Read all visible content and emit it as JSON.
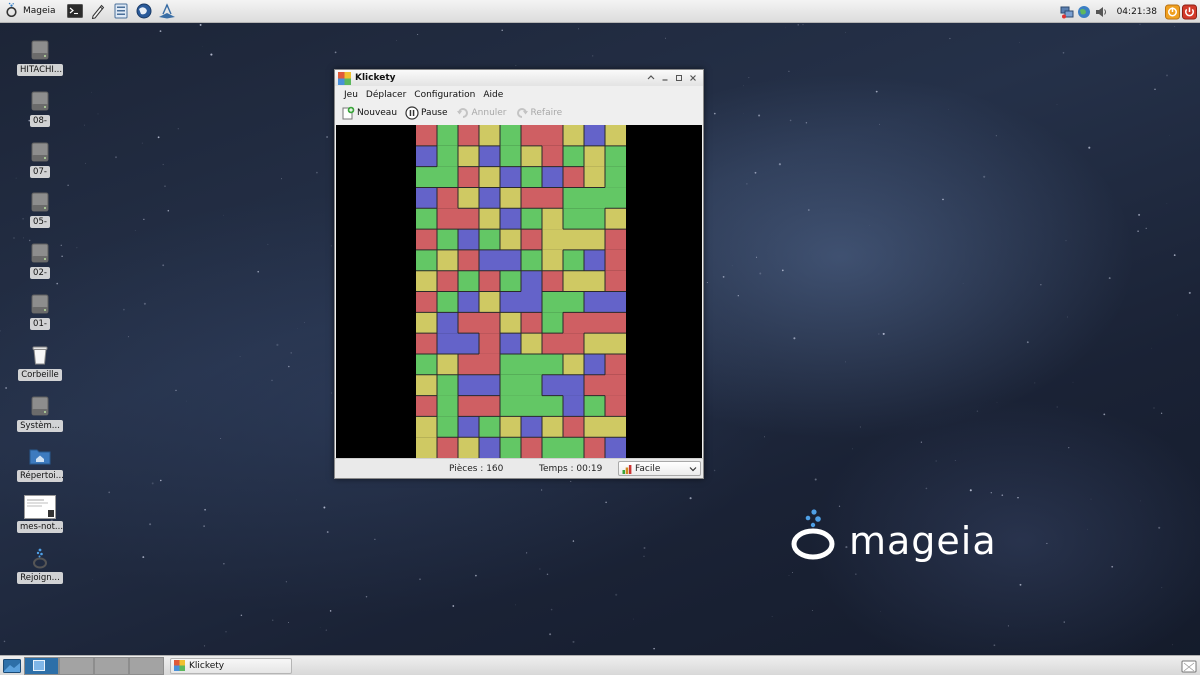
{
  "top_panel": {
    "menu_label": "Mageia",
    "launchers": [
      "terminal-icon",
      "text-editor-icon",
      "file-manager-icon",
      "web-browser-icon",
      "package-installer-icon"
    ],
    "clock": "04:21:38",
    "tray": [
      "network-icon",
      "globe-icon",
      "volume-icon",
      "update-icon",
      "power-icon"
    ]
  },
  "desktop": {
    "icons": [
      {
        "label": "HITACHI...",
        "icon": "drive-icon"
      },
      {
        "label": "08-",
        "icon": "drive-icon"
      },
      {
        "label": "07-",
        "icon": "drive-icon"
      },
      {
        "label": "05-",
        "icon": "drive-icon"
      },
      {
        "label": "02-",
        "icon": "drive-icon"
      },
      {
        "label": "01-",
        "icon": "drive-icon"
      },
      {
        "label": "Corbeille",
        "icon": "trash-icon"
      },
      {
        "label": "Systèm...",
        "icon": "drive-icon"
      },
      {
        "label": "Répertoi...",
        "icon": "home-folder-icon"
      },
      {
        "label": "mes-not...",
        "icon": "document-thumbnail-icon"
      },
      {
        "label": "Rejoign...",
        "icon": "mageia-join-icon"
      }
    ],
    "logo_text": "mageia"
  },
  "window": {
    "title": "Klickety",
    "menu": [
      "Jeu",
      "Déplacer",
      "Configuration",
      "Aide"
    ],
    "toolbar": {
      "new_label": "Nouveau",
      "pause_label": "Pause",
      "undo_label": "Annuler",
      "redo_label": "Refaire"
    },
    "board": {
      "columns": 10,
      "rows": 16,
      "colors": {
        "R": "#cf5f63",
        "G": "#63c765",
        "Y": "#cfc963",
        "B": "#6463c9"
      },
      "grid": [
        "RGRYGRRYBY",
        "BGYBGYRGYG",
        "GGRYBGBRYG",
        "BRYBYRRGGG",
        "GRRYBGYGGY",
        "RGBGYRYYYR",
        "GYRBBGYGBR",
        "YRGRGBRYYR",
        "RGBYBBGGBB",
        "YBRRYRGRRR",
        "RBBRBYRRYY",
        "GYRRGGGYBR",
        "YGBBGGBBRR",
        "RGRRGGGBGR",
        "YGBGYBYRYY",
        "YRYBGRGGRB"
      ]
    },
    "status": {
      "pieces": "Pièces : 160",
      "time": "Temps : 00:19",
      "difficulty": "Facile"
    }
  },
  "taskbar": {
    "workspaces": 4,
    "active_workspace": 1,
    "task_label": "Klickety"
  }
}
